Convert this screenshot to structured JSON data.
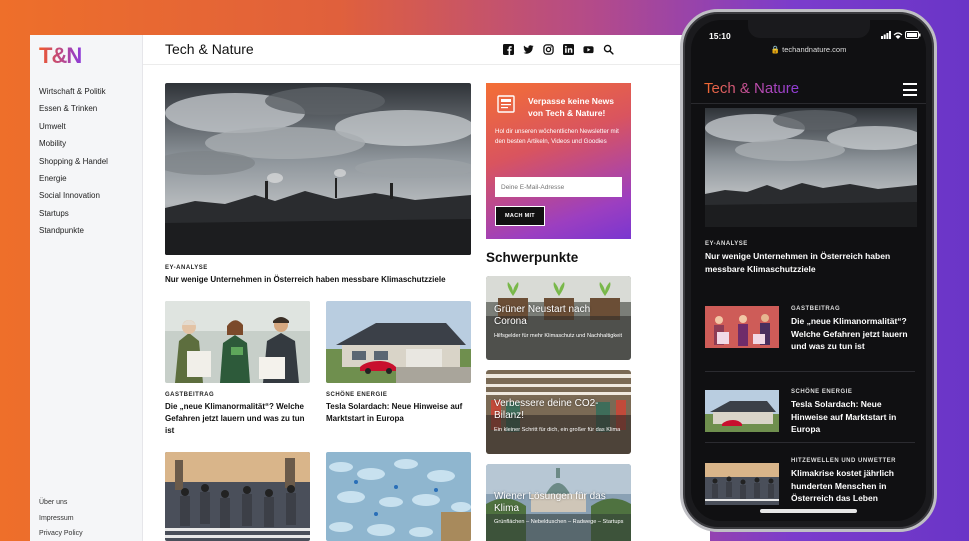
{
  "desktop": {
    "logo": "T&N",
    "site_title": "Tech & Nature",
    "nav": [
      "Wirtschaft & Politik",
      "Essen & Trinken",
      "Umwelt",
      "Mobility",
      "Shopping & Handel",
      "Energie",
      "Social Innovation",
      "Startups",
      "Standpunkte"
    ],
    "footer_links": [
      "Über uns",
      "Impressum",
      "Privacy Policy"
    ],
    "social_icons": [
      "facebook-icon",
      "twitter-icon",
      "instagram-icon",
      "linkedin-icon",
      "youtube-icon",
      "search-icon"
    ],
    "hero": {
      "kicker": "EY-Analyse",
      "title": "Nur wenige Unternehmen in Österreich haben messbare Klimaschutzziele"
    },
    "cards": [
      {
        "kicker": "Gastbeitrag",
        "title": "Die „neue Klimanormalität“? Welche Gefahren jetzt lauern und was zu tun ist"
      },
      {
        "kicker": "Schöne Energie",
        "title": "Tesla Solardach: Neue Hinweise auf Marktstart in Europa"
      }
    ],
    "newsletter": {
      "title": "Verpasse keine News von Tech & Nature!",
      "text": "Hol dir unseren wöchentlichen Newsletter mit den besten Artikeln, Videos und Goodies",
      "input_placeholder": "Deine E-Mail-Adresse",
      "button": "MACH MIT"
    },
    "schwerpunkte": {
      "heading": "Schwerpunkte",
      "items": [
        {
          "title": "Grüner Neustart nach Corona",
          "subtitle": "Hilfsgelder für mehr Klimaschutz und Nachhaltigkeit"
        },
        {
          "title": "Verbessere deine CO2-Bilanz!",
          "subtitle": "Ein kleiner Schritt für dich, ein großer für das Klima"
        },
        {
          "title": "Wiener Lösungen für das Klima",
          "subtitle": "Grünflächen – Nebelduschen – Radwege – Startups"
        }
      ]
    }
  },
  "phone": {
    "time": "15:10",
    "url": "techandnature.com",
    "logo": "Tech & Nature",
    "hero": {
      "kicker": "EY-ANALYSE",
      "title": "Nur wenige Unternehmen in Österreich haben messbare Klimaschutzziele"
    },
    "rows": [
      {
        "kicker": "GASTBEITRAG",
        "title": "Die „neue Klimanormalität“? Welche Gefahren jetzt lauern und was zu tun ist"
      },
      {
        "kicker": "SCHÖNE ENERGIE",
        "title": "Tesla Solardach: Neue Hinweise auf Marktstart in Europa"
      },
      {
        "kicker": "HITZEWELLEN UND UNWETTER",
        "title": "Klimakrise kostet jährlich hunderten Menschen in Österreich das Leben"
      }
    ]
  },
  "colors": {
    "brand_orange": "#f0592b",
    "brand_purple": "#8d3bd8",
    "phone_bg": "#101012"
  }
}
